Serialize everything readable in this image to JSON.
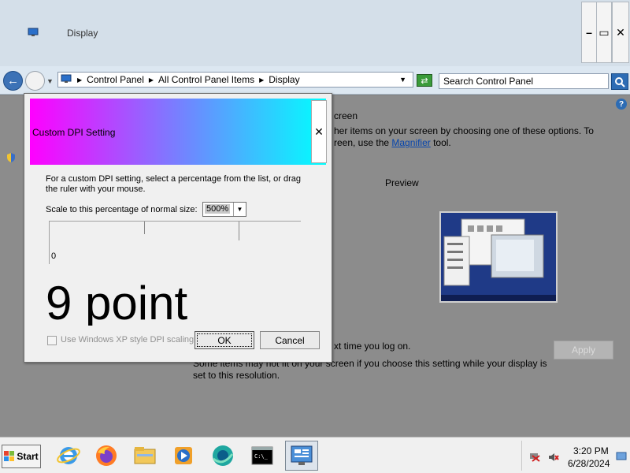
{
  "window": {
    "title": "Display",
    "min_label": "–",
    "max_label": "▭",
    "close_label": "✕"
  },
  "navigation": {
    "breadcrumbs": [
      "Control Panel",
      "All Control Panel Items",
      "Display"
    ],
    "search_placeholder": "Search Control Panel"
  },
  "background_page": {
    "heading_fragment": "creen",
    "desc_line1": "her items on your screen by choosing one of these options. To",
    "desc_line2_prefix": "reen, use the ",
    "magnifier_link": "Magnifier",
    "desc_line2_suffix": " tool.",
    "preview_label": "Preview",
    "logon_fragment": "xt time you log on.",
    "warning_text": "Some items may not fit on your screen if you choose this setting while your display is set to this resolution.",
    "apply_label": "Apply"
  },
  "dialog": {
    "title": "Custom DPI Setting",
    "close_label": "✕",
    "intro": "For a custom DPI setting, select a percentage from the list, or drag the ruler with your mouse.",
    "scale_label": "Scale to this percentage of normal size:",
    "scale_value": "500%",
    "ruler_zero": "0",
    "sample_text": "9 point",
    "xp_scaling_label": "Use Windows XP style DPI scaling",
    "xp_scaling_checked": false,
    "xp_scaling_enabled": false,
    "ok_label": "OK",
    "cancel_label": "Cancel"
  },
  "taskbar": {
    "start_label": "Start",
    "apps": [
      "internet-explorer-icon",
      "firefox-icon",
      "file-explorer-icon",
      "media-player-icon",
      "browser-icon",
      "command-prompt-icon",
      "control-panel-icon"
    ],
    "time": "3:20 PM",
    "date": "6/28/2024"
  },
  "colors": {
    "dialog_gradient_start": "#ff00ff",
    "dialog_gradient_end": "#00ffff",
    "link": "#0645ad"
  }
}
